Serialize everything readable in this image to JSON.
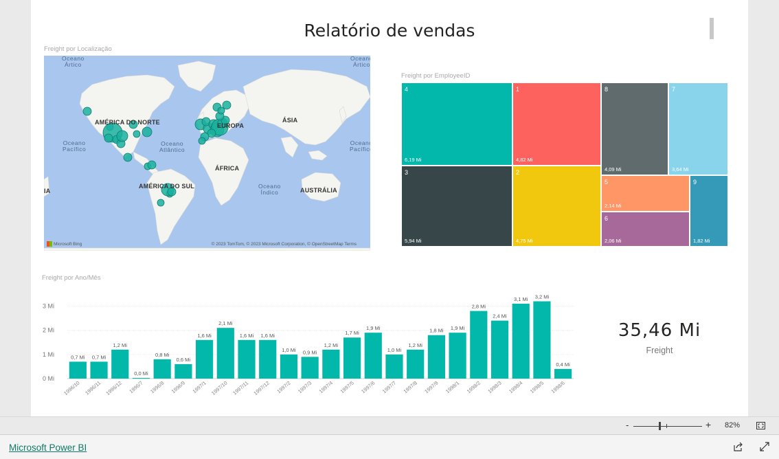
{
  "report": {
    "title": "Relatório de vendas"
  },
  "map_visual": {
    "title": "Freight por Localização",
    "continent_labels": {
      "north_america": "AMÉRICA DO NORTE",
      "europe": "EUROPA",
      "asia": "ÁSIA",
      "africa": "ÁFRICA",
      "south_america": "AMÉRICA DO SUL",
      "australia": "AUSTRÁLIA",
      "edge_left": "IA"
    },
    "ocean_labels": {
      "arctic_left": "Oceano\nÁrtico",
      "arctic_right": "Oceano\nÁrtico",
      "pacific_left": "Oceano\nPacífico",
      "atlantic": "Oceano\nAtlântico",
      "pacific_right": "Oceano\nPacífico",
      "indian": "Oceano\nÍndico"
    },
    "credit": "© 2023 TomTom, © 2023 Microsoft Corporation, © OpenStreetMap  Terms",
    "bing": "Microsoft Bing",
    "bubble_color": "#1ab09f"
  },
  "treemap_visual": {
    "title": "Freight por EmployeeID",
    "tiles": [
      {
        "key": "4",
        "value": "6,19 Mi",
        "color": "#01b8aa"
      },
      {
        "key": "1",
        "value": "4,82 Mi",
        "color": "#fd625e"
      },
      {
        "key": "8",
        "value": "4,09 Mi",
        "color": "#5f6b6d"
      },
      {
        "key": "7",
        "value": "3,64 Mi",
        "color": "#8ad4eb"
      },
      {
        "key": "3",
        "value": "5,94 Mi",
        "color": "#374649"
      },
      {
        "key": "2",
        "value": "4,75 Mi",
        "color": "#f2c80f"
      },
      {
        "key": "5",
        "value": "2,14 Mi",
        "color": "#fe9666"
      },
      {
        "key": "9",
        "value": "1,82 Mi",
        "color": "#3599b8"
      },
      {
        "key": "6",
        "value": "2,06 Mi",
        "color": "#a66999"
      }
    ]
  },
  "bar_visual": {
    "title": "Freight por Ano/Mês",
    "bar_color": "#01b8aa"
  },
  "chart_data": {
    "type": "bar",
    "title": "Freight por Ano/Mês",
    "categories": [
      "1996/10",
      "1996/11",
      "1996/12",
      "1996/7",
      "1996/8",
      "1996/9",
      "1997/1",
      "1997/10",
      "1997/11",
      "1997/12",
      "1997/2",
      "1997/3",
      "1997/4",
      "1997/5",
      "1997/6",
      "1997/7",
      "1997/8",
      "1997/9",
      "1998/1",
      "1998/2",
      "1998/3",
      "1998/4",
      "1998/5",
      "1998/6"
    ],
    "values": [
      0.7,
      0.7,
      1.2,
      0.0,
      0.8,
      0.6,
      1.6,
      2.1,
      1.6,
      1.6,
      1.0,
      0.9,
      1.2,
      1.7,
      1.9,
      1.0,
      1.2,
      1.8,
      1.9,
      2.8,
      2.4,
      3.1,
      3.2,
      0.4
    ],
    "data_labels": [
      "0,7 Mi",
      "0,7 Mi",
      "1,2 Mi",
      "0,0 Mi",
      "0,8 Mi",
      "0,6 Mi",
      "1,6 Mi",
      "2,1 Mi",
      "1,6 Mi",
      "1,6 Mi",
      "1,0 Mi",
      "0,9 Mi",
      "1,2 Mi",
      "1,7 Mi",
      "1,9 Mi",
      "1,0 Mi",
      "1,2 Mi",
      "1,8 Mi",
      "1,9 Mi",
      "2,8 Mi",
      "2,4 Mi",
      "3,1 Mi",
      "3,2 Mi",
      "0,4 Mi"
    ],
    "y_ticks": [
      0,
      1,
      2,
      3
    ],
    "y_tick_labels": [
      "0 Mi",
      "1 Mi",
      "2 Mi",
      "3 Mi"
    ],
    "ylim": [
      0,
      3.3
    ],
    "grid": true
  },
  "kpi": {
    "value": "35,46 Mi",
    "label": "Freight"
  },
  "zoom": {
    "minus": "-",
    "plus": "+",
    "percent": "82%"
  },
  "footer": {
    "link": "Microsoft Power BI"
  },
  "icons": {
    "fit": "fit-to-page-icon",
    "share": "share-icon",
    "expand": "expand-icon"
  }
}
